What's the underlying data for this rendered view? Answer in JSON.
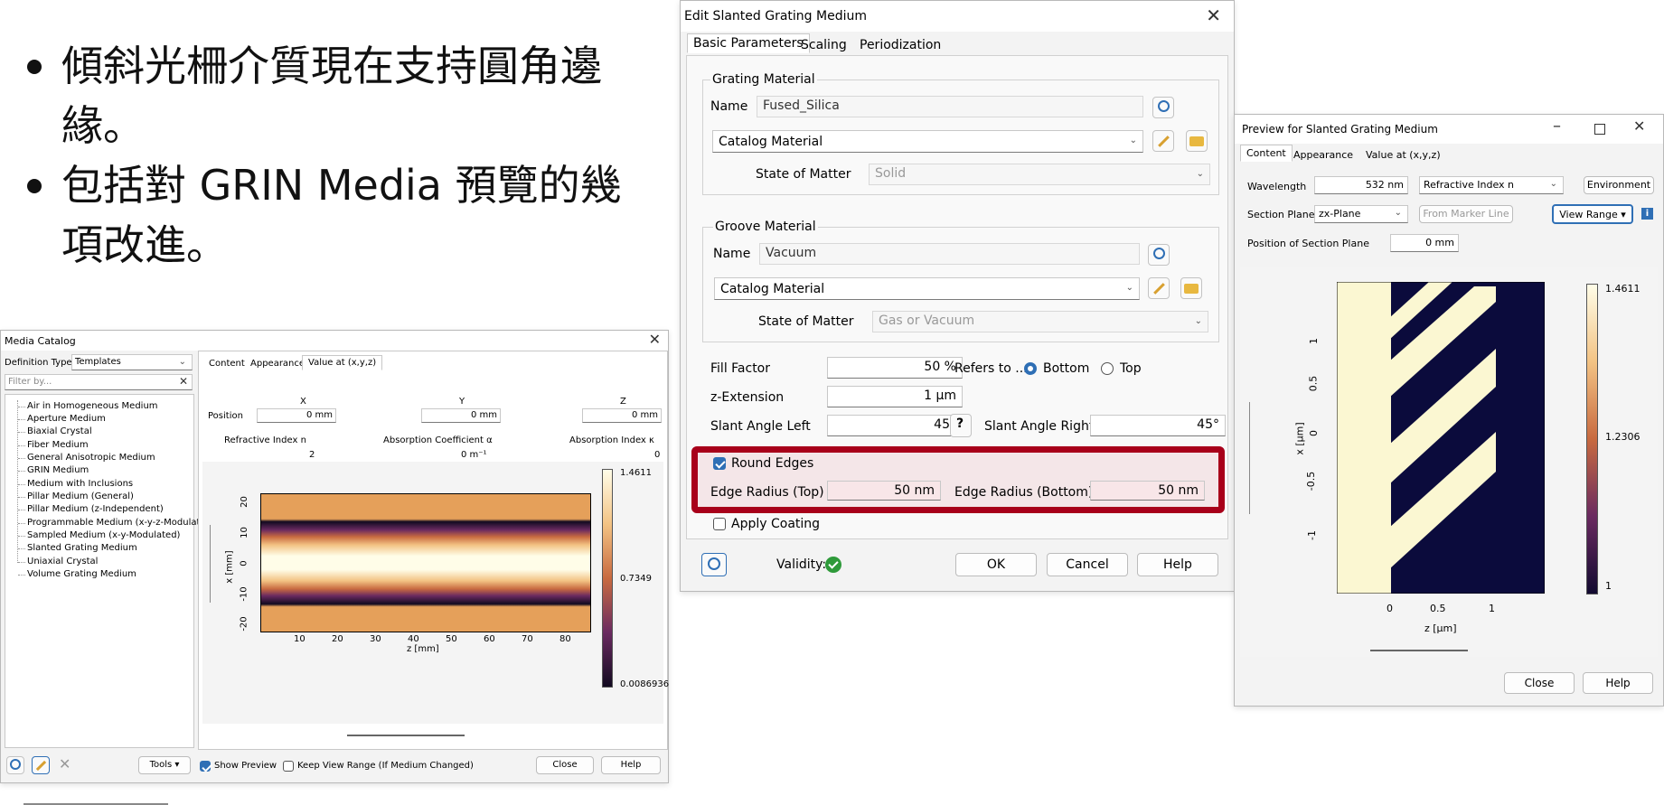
{
  "slide": {
    "bullets": [
      "傾斜光柵介質現在支持圓角邊緣。",
      "包括對 GRIN Media 預覽的幾項改進。"
    ]
  },
  "edit_dialog": {
    "title": "Edit Slanted Grating Medium",
    "tabs": [
      "Basic Parameters",
      "Scaling",
      "Periodization"
    ],
    "grating_material": {
      "group_label": "Grating Material",
      "name_label": "Name",
      "name_value": "Fused_Silica",
      "catalog": "Catalog Material",
      "state_label": "State of Matter",
      "state_value": "Solid"
    },
    "groove_material": {
      "group_label": "Groove Material",
      "name_label": "Name",
      "name_value": "Vacuum",
      "catalog": "Catalog Material",
      "state_label": "State of Matter",
      "state_value": "Gas or Vacuum"
    },
    "fill_factor_label": "Fill Factor",
    "fill_factor_value": "50 %",
    "refers_to_label": "Refers to ...",
    "bottom_label": "Bottom",
    "top_label": "Top",
    "z_extension_label": "z-Extension",
    "z_extension_value": "1 µm",
    "slant_left_label": "Slant Angle Left",
    "slant_left_value": "45°",
    "slant_right_label": "Slant Angle Right",
    "slant_right_value": "45°",
    "round_edges_label": "Round Edges",
    "edge_top_label": "Edge Radius (Top)",
    "edge_top_value": "50 nm",
    "edge_bottom_label": "Edge Radius (Bottom)",
    "edge_bottom_value": "50 nm",
    "apply_coating_label": "Apply Coating",
    "validity_label": "Validity:",
    "ok": "OK",
    "cancel": "Cancel",
    "help": "Help",
    "highlight_color": "#a8001a"
  },
  "media_catalog": {
    "title": "Media Catalog",
    "definition_type_label": "Definition Type",
    "definition_type_value": "Templates",
    "filter_placeholder": "Filter by...",
    "items": [
      "Air in Homogeneous Medium",
      "Aperture Medium",
      "Biaxial Crystal",
      "Fiber Medium",
      "General Anisotropic Medium",
      "GRIN Medium",
      "Medium with Inclusions",
      "Pillar Medium (General)",
      "Pillar Medium (z-Independent)",
      "Programmable Medium (x-y-z-Modulated)",
      "Sampled Medium (x-y-Modulated)",
      "Slanted Grating Medium",
      "Uniaxial Crystal",
      "Volume Grating Medium"
    ],
    "tabs": [
      "Content",
      "Appearance",
      "Value at (x,y,z)"
    ],
    "x_header": "X",
    "y_header": "Y",
    "z_header": "Z",
    "position_label": "Position",
    "pos_x": "0 mm",
    "pos_y": "0 mm",
    "pos_z": "0 mm",
    "n_label": "Refractive Index n",
    "n_value": "2",
    "alpha_label": "Absorption Coefficient α",
    "alpha_value": "0 m⁻¹",
    "kappa_label": "Absorption Index κ",
    "kappa_value": "0",
    "plot": {
      "xlabel": "z [mm]",
      "ylabel": "x [mm]",
      "xticks": [
        "10",
        "20",
        "30",
        "40",
        "50",
        "60",
        "70",
        "80"
      ],
      "yticks": [
        "20",
        "10",
        "0",
        "-10",
        "-20"
      ],
      "colorbar": [
        "1.4611",
        "0.7349",
        "0.0086936"
      ]
    },
    "tools_label": "Tools",
    "show_preview_label": "Show Preview",
    "keep_range_label": "Keep View Range (If Medium Changed)",
    "close": "Close",
    "help": "Help"
  },
  "preview": {
    "title": "Preview for Slanted Grating Medium",
    "tabs": [
      "Content",
      "Appearance",
      "Value at (x,y,z)"
    ],
    "wavelength_label": "Wavelength",
    "wavelength_value": "532 nm",
    "quantity_value": "Refractive Index n",
    "environment": "Environment",
    "section_plane_label": "Section Plane",
    "section_plane_value": "zx-Plane",
    "from_marker": "From Marker Line",
    "view_range": "View Range",
    "pos_section_label": "Position of Section Plane",
    "pos_section_value": "0 mm",
    "plot": {
      "xlabel": "z [µm]",
      "ylabel": "x [µm]",
      "xticks": [
        "0",
        "0.5",
        "1"
      ],
      "yticks": [
        "1",
        "0.5",
        "0",
        "-0.5",
        "-1"
      ],
      "colorbar": [
        "1.4611",
        "1.2306",
        "1"
      ]
    },
    "close": "Close",
    "help": "Help"
  }
}
